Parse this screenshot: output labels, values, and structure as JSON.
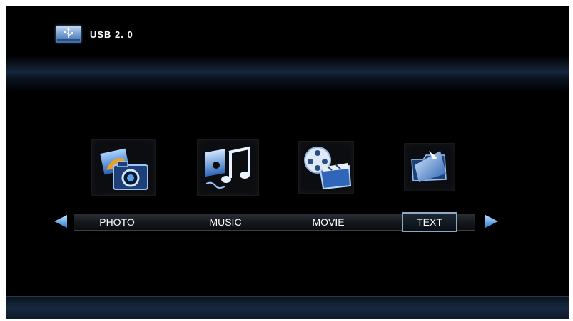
{
  "header": {
    "title": "USB 2. 0",
    "icon": "usb-drive-icon"
  },
  "menu": {
    "items": [
      {
        "label": "PHOTO",
        "icon": "photo-camera-icon"
      },
      {
        "label": "MUSIC",
        "icon": "music-note-icon"
      },
      {
        "label": "MOVIE",
        "icon": "film-reel-icon"
      },
      {
        "label": "TEXT",
        "icon": "text-folder-icon"
      }
    ],
    "selected": "TEXT"
  },
  "navigation": {
    "left": "arrow-left-icon",
    "right": "arrow-right-icon"
  },
  "colors": {
    "background": "#000000",
    "accent": "#4aa0e8",
    "selection_border": "#8fa8c4",
    "text": "#ffffff"
  }
}
